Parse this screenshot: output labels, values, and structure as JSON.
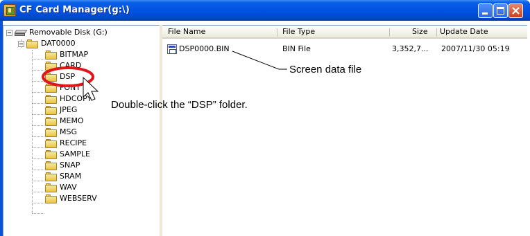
{
  "window": {
    "title": "CF Card Manager(g:\\)",
    "controls": {
      "minimize": "minimize",
      "maximize": "maximize",
      "close": "close"
    }
  },
  "tree": {
    "root": {
      "label": "Removable Disk (G:)",
      "icon": "removable-disk-icon",
      "expanded": true
    },
    "dat": {
      "label": "DAT0000",
      "icon": "folder-icon",
      "expanded": true
    },
    "folders": [
      "BITMAP",
      "CARD",
      "DSP",
      "FONT",
      "HDCOPY",
      "JPEG",
      "MEMO",
      "MSG",
      "RECIPE",
      "SAMPLE",
      "SNAP",
      "SRAM",
      "WAV",
      "WEBSERV"
    ]
  },
  "list": {
    "columns": [
      "File Name",
      "File Type",
      "Size",
      "Update Date"
    ],
    "rows": [
      {
        "name": "DSP0000.BIN",
        "type": "BIN File",
        "size": "3,352,7...",
        "date": "2007/11/30 05:19"
      }
    ]
  },
  "annotations": {
    "screen_data": "Screen data file",
    "double_click": "Double-click the “DSP” folder."
  },
  "colors": {
    "titlebar": "#0054e3",
    "highlight_ellipse": "#e0161b",
    "folder": "#e8c24a"
  }
}
